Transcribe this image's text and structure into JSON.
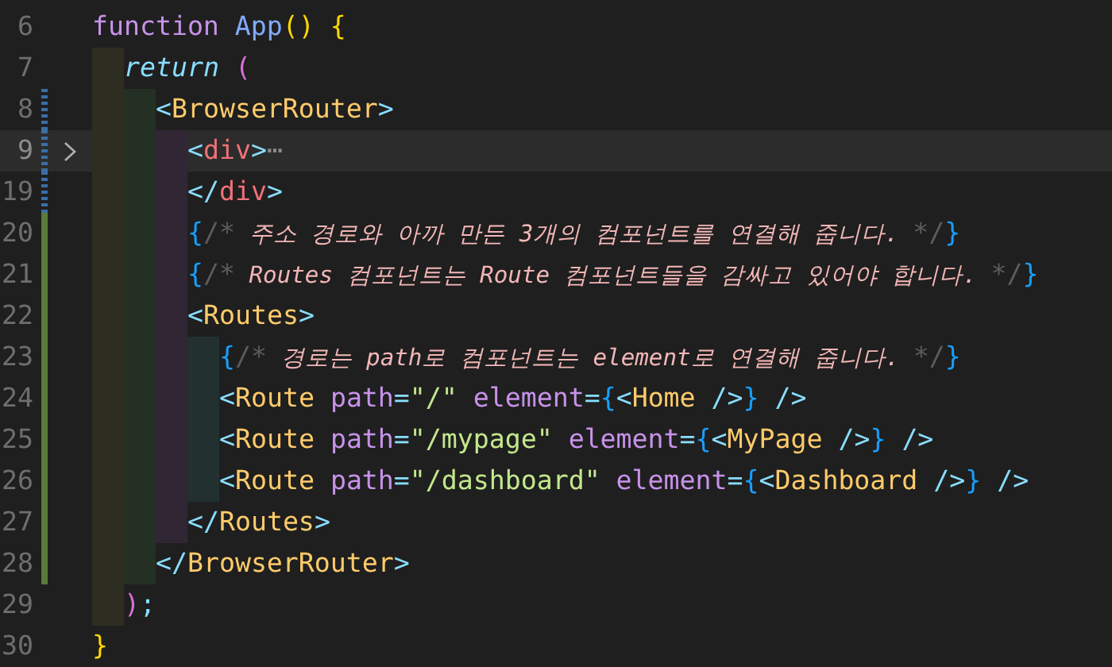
{
  "editor": {
    "lines": [
      {
        "number": "6",
        "modified": false,
        "added": false,
        "folded": false,
        "current": false,
        "tokens": [
          {
            "text": "function ",
            "kind": "keyword"
          },
          {
            "text": "App",
            "kind": "function"
          },
          {
            "text": "() {",
            "kind": "paren1"
          }
        ],
        "children": [
          {
            "number": "7",
            "modified": false,
            "added": false,
            "folded": false,
            "current": false,
            "tokens": [
              {
                "text": "return ",
                "kind": "control"
              },
              {
                "text": "(",
                "kind": "paren2"
              }
            ],
            "children": [
              {
                "number": "8",
                "modified": true,
                "added": false,
                "folded": false,
                "current": false,
                "tokens": [
                  {
                    "text": "<",
                    "kind": "punct"
                  },
                  {
                    "text": "BrowserRouter",
                    "kind": "component"
                  },
                  {
                    "text": ">",
                    "kind": "punct"
                  }
                ],
                "children": [
                  {
                    "number": "9",
                    "modified": true,
                    "added": false,
                    "folded": true,
                    "current": true,
                    "tokens": [
                      {
                        "text": "<",
                        "kind": "punct"
                      },
                      {
                        "text": "div",
                        "kind": "tag"
                      },
                      {
                        "text": ">",
                        "kind": "punct"
                      },
                      {
                        "text": "⋯",
                        "kind": "ellipsis"
                      }
                    ]
                  },
                  {
                    "number": "19",
                    "modified": true,
                    "added": false,
                    "folded": false,
                    "current": false,
                    "tokens": [
                      {
                        "text": "</",
                        "kind": "punct"
                      },
                      {
                        "text": "div",
                        "kind": "tag"
                      },
                      {
                        "text": ">",
                        "kind": "punct"
                      }
                    ]
                  },
                  {
                    "number": "20",
                    "modified": false,
                    "added": true,
                    "folded": false,
                    "current": false,
                    "tokens": [
                      {
                        "text": "{",
                        "kind": "brace"
                      },
                      {
                        "text": "/*",
                        "kind": "comment-mark"
                      },
                      {
                        "text": " 주소 경로와 아까 만든 3개의 컴포넌트를 연결해 줍니다. ",
                        "kind": "comment"
                      },
                      {
                        "text": "*/",
                        "kind": "comment-mark"
                      },
                      {
                        "text": "}",
                        "kind": "brace"
                      }
                    ]
                  },
                  {
                    "number": "21",
                    "modified": false,
                    "added": true,
                    "folded": false,
                    "current": false,
                    "tokens": [
                      {
                        "text": "{",
                        "kind": "brace"
                      },
                      {
                        "text": "/*",
                        "kind": "comment-mark"
                      },
                      {
                        "text": " Routes 컴포넌트는 Route 컴포넌트들을 감싸고 있어야 합니다. ",
                        "kind": "comment"
                      },
                      {
                        "text": "*/",
                        "kind": "comment-mark"
                      },
                      {
                        "text": "}",
                        "kind": "brace"
                      }
                    ]
                  },
                  {
                    "number": "22",
                    "modified": false,
                    "added": true,
                    "folded": false,
                    "current": false,
                    "tokens": [
                      {
                        "text": "<",
                        "kind": "punct"
                      },
                      {
                        "text": "Routes",
                        "kind": "component"
                      },
                      {
                        "text": ">",
                        "kind": "punct"
                      }
                    ],
                    "children": [
                      {
                        "number": "23",
                        "modified": false,
                        "added": true,
                        "folded": false,
                        "current": false,
                        "tokens": [
                          {
                            "text": "{",
                            "kind": "brace"
                          },
                          {
                            "text": "/*",
                            "kind": "comment-mark"
                          },
                          {
                            "text": " 경로는 path로 컴포넌트는 element로 연결해 줍니다. ",
                            "kind": "comment"
                          },
                          {
                            "text": "*/",
                            "kind": "comment-mark"
                          },
                          {
                            "text": "}",
                            "kind": "brace"
                          }
                        ]
                      },
                      {
                        "number": "24",
                        "modified": false,
                        "added": true,
                        "folded": false,
                        "current": false,
                        "tokens": [
                          {
                            "text": "<",
                            "kind": "punct"
                          },
                          {
                            "text": "Route ",
                            "kind": "component"
                          },
                          {
                            "text": "path",
                            "kind": "attr"
                          },
                          {
                            "text": "=",
                            "kind": "punct"
                          },
                          {
                            "text": "\"/\" ",
                            "kind": "string"
                          },
                          {
                            "text": "element",
                            "kind": "attr"
                          },
                          {
                            "text": "=",
                            "kind": "punct"
                          },
                          {
                            "text": "{",
                            "kind": "brace"
                          },
                          {
                            "text": "<",
                            "kind": "punct"
                          },
                          {
                            "text": "Home",
                            "kind": "component"
                          },
                          {
                            "text": " />",
                            "kind": "punct"
                          },
                          {
                            "text": "}",
                            "kind": "brace"
                          },
                          {
                            "text": " />",
                            "kind": "punct"
                          }
                        ]
                      },
                      {
                        "number": "25",
                        "modified": false,
                        "added": true,
                        "folded": false,
                        "current": false,
                        "tokens": [
                          {
                            "text": "<",
                            "kind": "punct"
                          },
                          {
                            "text": "Route ",
                            "kind": "component"
                          },
                          {
                            "text": "path",
                            "kind": "attr"
                          },
                          {
                            "text": "=",
                            "kind": "punct"
                          },
                          {
                            "text": "\"/mypage\" ",
                            "kind": "string"
                          },
                          {
                            "text": "element",
                            "kind": "attr"
                          },
                          {
                            "text": "=",
                            "kind": "punct"
                          },
                          {
                            "text": "{",
                            "kind": "brace"
                          },
                          {
                            "text": "<",
                            "kind": "punct"
                          },
                          {
                            "text": "MyPage",
                            "kind": "component"
                          },
                          {
                            "text": " />",
                            "kind": "punct"
                          },
                          {
                            "text": "}",
                            "kind": "brace"
                          },
                          {
                            "text": " />",
                            "kind": "punct"
                          }
                        ]
                      },
                      {
                        "number": "26",
                        "modified": false,
                        "added": true,
                        "folded": false,
                        "current": false,
                        "tokens": [
                          {
                            "text": "<",
                            "kind": "punct"
                          },
                          {
                            "text": "Route ",
                            "kind": "component"
                          },
                          {
                            "text": "path",
                            "kind": "attr"
                          },
                          {
                            "text": "=",
                            "kind": "punct"
                          },
                          {
                            "text": "\"/dashboard\" ",
                            "kind": "string"
                          },
                          {
                            "text": "element",
                            "kind": "attr"
                          },
                          {
                            "text": "=",
                            "kind": "punct"
                          },
                          {
                            "text": "{",
                            "kind": "brace"
                          },
                          {
                            "text": "<",
                            "kind": "punct"
                          },
                          {
                            "text": "Dashboard",
                            "kind": "component"
                          },
                          {
                            "text": " />",
                            "kind": "punct"
                          },
                          {
                            "text": "}",
                            "kind": "brace"
                          },
                          {
                            "text": " />",
                            "kind": "punct"
                          }
                        ]
                      }
                    ]
                  },
                  {
                    "number": "27",
                    "modified": false,
                    "added": true,
                    "folded": false,
                    "current": false,
                    "tokens": [
                      {
                        "text": "</",
                        "kind": "punct"
                      },
                      {
                        "text": "Routes",
                        "kind": "component"
                      },
                      {
                        "text": ">",
                        "kind": "punct"
                      }
                    ]
                  }
                ]
              },
              {
                "number": "28",
                "modified": false,
                "added": true,
                "folded": false,
                "current": false,
                "tokens": [
                  {
                    "text": "</",
                    "kind": "punct"
                  },
                  {
                    "text": "BrowserRouter",
                    "kind": "component"
                  },
                  {
                    "text": ">",
                    "kind": "punct"
                  }
                ]
              }
            ]
          },
          {
            "number": "29",
            "modified": false,
            "added": false,
            "folded": false,
            "current": false,
            "tokens": [
              {
                "text": ")",
                "kind": "paren2"
              },
              {
                "text": ";",
                "kind": "punct"
              }
            ]
          }
        ]
      },
      {
        "number": "30",
        "modified": false,
        "added": false,
        "folded": false,
        "current": false,
        "tokens": [
          {
            "text": "}",
            "kind": "paren1"
          }
        ]
      }
    ]
  }
}
